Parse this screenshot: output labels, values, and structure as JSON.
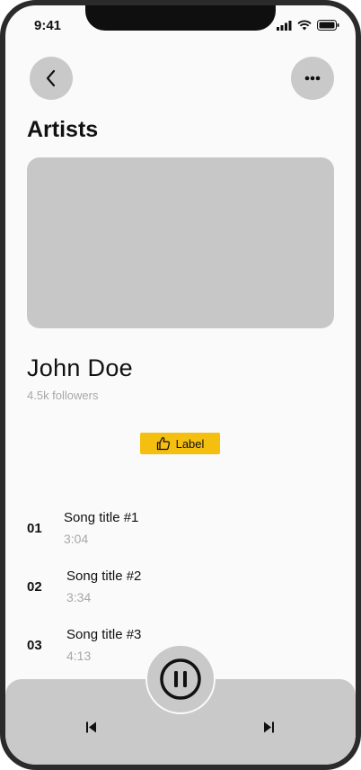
{
  "status_bar": {
    "time": "9:41"
  },
  "header": {
    "title": "Artists"
  },
  "artist": {
    "name": "John Doe",
    "followers": "4.5k followers"
  },
  "label_button": {
    "text": "Label"
  },
  "songs": [
    {
      "number": "01",
      "title": "Song title #1",
      "duration": "3:04"
    },
    {
      "number": "02",
      "title": "Song title #2",
      "duration": "3:34"
    },
    {
      "number": "03",
      "title": "Song title #3",
      "duration": "4:13"
    }
  ],
  "colors": {
    "accent": "#f5bf10",
    "placeholder": "#c7c7c7",
    "muted_text": "#a8a8a8"
  }
}
